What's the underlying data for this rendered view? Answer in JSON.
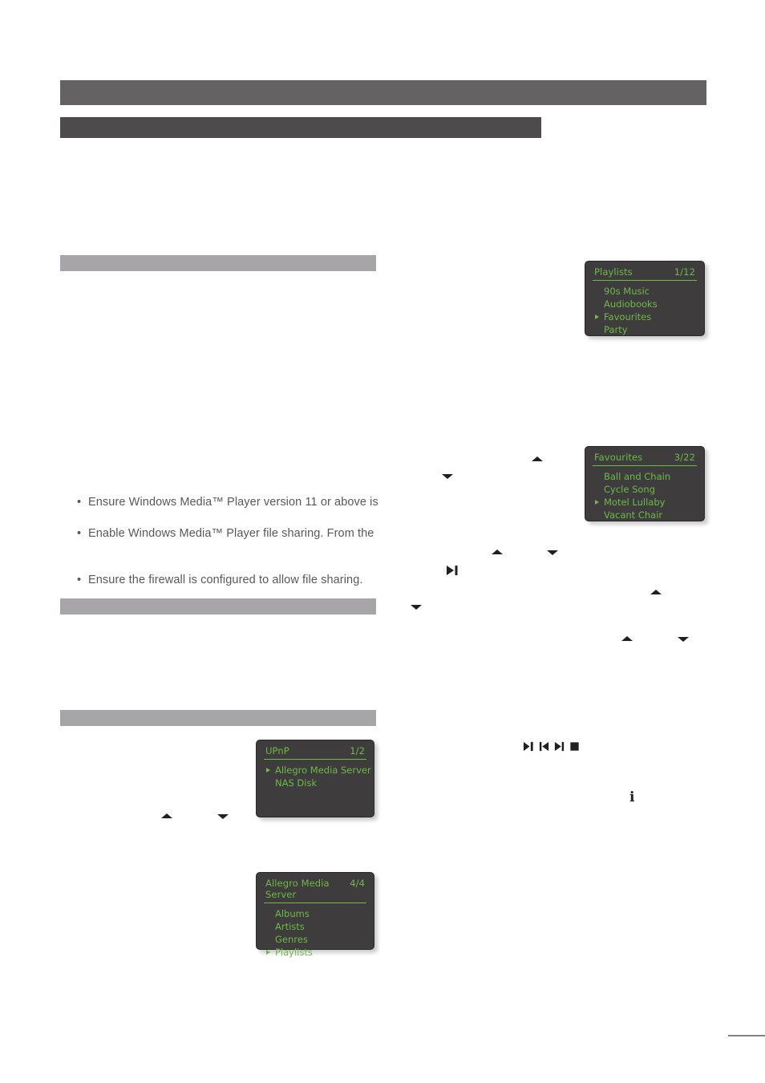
{
  "document": {
    "heading_bars": [
      {
        "name": "chapter-title-bar"
      },
      {
        "name": "section-title-bar"
      },
      {
        "name": "subsection-bar-1"
      },
      {
        "name": "subsection-bar-2"
      },
      {
        "name": "subsection-bar-3"
      }
    ],
    "bullets": [
      "Ensure Windows Media™ Player version 11 or above is",
      "Enable Windows Media™ Player file sharing. From the",
      "Ensure the firewall is configured to allow file sharing."
    ],
    "bullet_marker": "•"
  },
  "panels": {
    "playlists": {
      "title": "Playlists",
      "count": "1/12",
      "items": [
        {
          "label": "90s Music",
          "selected": false
        },
        {
          "label": "Audiobooks",
          "selected": false
        },
        {
          "label": "Favourites",
          "selected": true
        },
        {
          "label": "Party",
          "selected": false
        }
      ]
    },
    "favourites": {
      "title": "Favourites",
      "count": "3/22",
      "items": [
        {
          "label": "Ball and Chain",
          "selected": false
        },
        {
          "label": "Cycle Song",
          "selected": false
        },
        {
          "label": "Motel Lullaby",
          "selected": true
        },
        {
          "label": "Vacant Chair",
          "selected": false
        }
      ]
    },
    "upnp": {
      "title": "UPnP",
      "count": "1/2",
      "items": [
        {
          "label": "Allegro Media Server",
          "selected": true
        },
        {
          "label": "NAS Disk",
          "selected": false
        }
      ]
    },
    "allegro": {
      "title": "Allegro Media Server",
      "count": "4/4",
      "items": [
        {
          "label": "Albums",
          "selected": false
        },
        {
          "label": "Artists",
          "selected": false
        },
        {
          "label": "Genres",
          "selected": false
        },
        {
          "label": "Playlists",
          "selected": true
        }
      ]
    }
  },
  "icons": {
    "arrow_up": "up-arrow-icon",
    "arrow_down": "down-arrow-icon",
    "play_pause": "play-pause-icon",
    "previous": "previous-track-icon",
    "next": "next-track-icon",
    "stop": "stop-icon",
    "info": "i"
  },
  "colors": {
    "panel_background": "#3e3c3d",
    "panel_text_green": "#6cbb45",
    "bar_dark": "#646263",
    "bar_darker": "#4d4b4c",
    "bar_gray": "#a7a5a8",
    "body_text": "#58585a",
    "glyph": "#231f20"
  }
}
